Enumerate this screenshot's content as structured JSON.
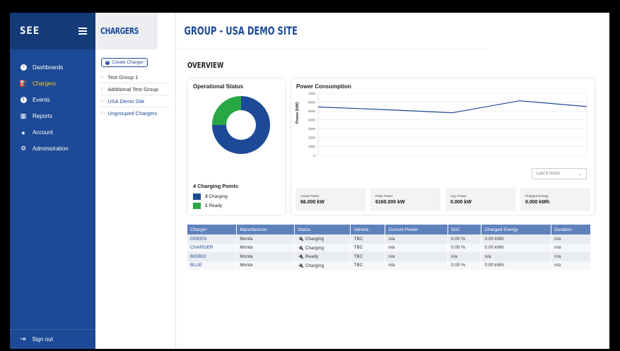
{
  "sidebar": {
    "logo_text": "SEE",
    "nav": [
      {
        "label": "Dashboards",
        "icon": "dashboard-icon"
      },
      {
        "label": "Chargers",
        "icon": "charger-icon",
        "active": true
      },
      {
        "label": "Events",
        "icon": "events-icon"
      },
      {
        "label": "Reports",
        "icon": "reports-icon"
      },
      {
        "label": "Account",
        "icon": "account-icon"
      },
      {
        "label": "Administration",
        "icon": "administration-icon"
      }
    ],
    "sign_out": "Sign out"
  },
  "chargers_panel": {
    "title": "CHARGERS",
    "create_button": "Create Charger",
    "groups": [
      "Test Group 1",
      "Additional Test Group",
      "USA Demo Site",
      "Ungrouped Chargers"
    ]
  },
  "main": {
    "title": "GROUP - USA DEMO SITE",
    "overview": "OVERVIEW"
  },
  "operational_status": {
    "title": "Operational Status",
    "charging_points": "4 Charging Points",
    "legend": [
      {
        "count": "3",
        "label": "Charging",
        "color": "#1d4a96"
      },
      {
        "count": "1",
        "label": "Ready",
        "color": "#27a844"
      }
    ]
  },
  "power_consumption": {
    "title": "Power Consumption",
    "ylabel": "Power [kW]",
    "time_select": "Last 6 hours",
    "stats": [
      {
        "label": "Actual Power",
        "value": "66.000 kW"
      },
      {
        "label": "Peak Power",
        "value": "6160.000 kW"
      },
      {
        "label": "Avg. Power",
        "value": "0.000 kW"
      },
      {
        "label": "Charged Energy",
        "value": "0.000 kWh"
      }
    ]
  },
  "chart_data": [
    {
      "type": "pie",
      "title": "Operational Status",
      "categories": [
        "Charging",
        "Ready"
      ],
      "values": [
        3,
        1
      ],
      "colors": [
        "#1d4a96",
        "#27a844"
      ]
    },
    {
      "type": "line",
      "title": "Power Consumption",
      "ylabel": "Power [kW]",
      "ylim": [
        0,
        7000
      ],
      "yticks": [
        0,
        1000,
        2000,
        3000,
        4000,
        5000,
        6000,
        7000
      ],
      "x": [
        0,
        1,
        2,
        3,
        4
      ],
      "series": [
        {
          "values": [
            5450,
            5150,
            4800,
            6150,
            5500
          ]
        }
      ],
      "grid": true
    }
  ],
  "table": {
    "columns": [
      "Charger",
      "Manufacturer",
      "Status",
      "Vehicle",
      "Current Power",
      "SoC",
      "Charged Energy",
      "Duration"
    ],
    "rows": [
      [
        "GREEN",
        "Monta",
        "Charging",
        "TBC",
        "n/a",
        "0.00 %",
        "0.00 kWh",
        "n/a"
      ],
      [
        "CHARGER",
        "Monta",
        "Charging",
        "TBC",
        "n/a",
        "0.00 %",
        "0.00 kWh",
        "n/a"
      ],
      [
        "BIGBOI",
        "Monta",
        "Ready",
        "TBC",
        "n/a",
        "n/a",
        "n/a",
        "n/a"
      ],
      [
        "BLUE",
        "Monta",
        "Charging",
        "TBC",
        "n/a",
        "0.00 %",
        "0.00 kWh",
        "n/a"
      ]
    ]
  }
}
